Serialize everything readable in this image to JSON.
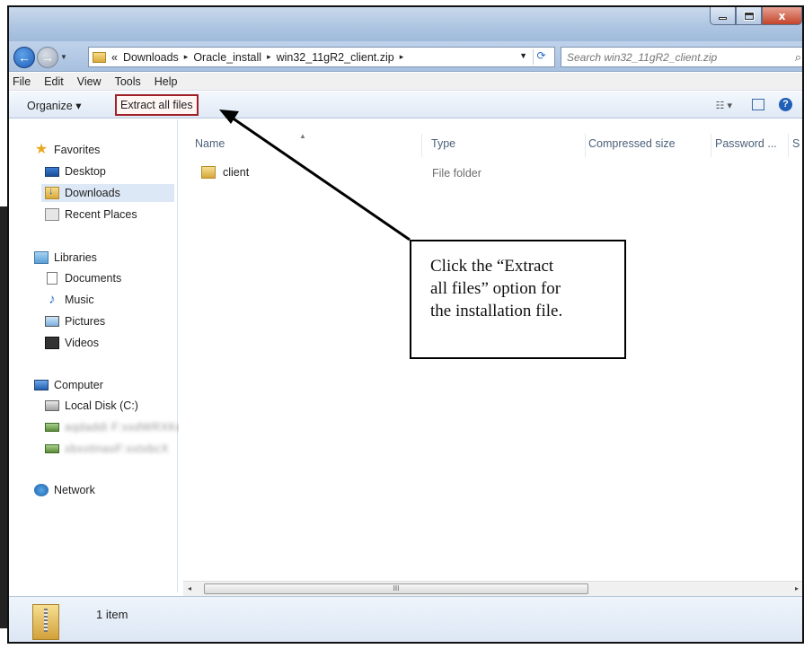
{
  "window": {
    "close_glyph": "x"
  },
  "address_bar": {
    "overflow": "«",
    "crumbs": [
      "Downloads",
      "Oracle_install",
      "win32_11gR2_client.zip"
    ],
    "separator": "▸"
  },
  "search": {
    "placeholder": "Search win32_11gR2_client.zip"
  },
  "menu": {
    "file": "File",
    "edit": "Edit",
    "view": "View",
    "tools": "Tools",
    "help": "Help"
  },
  "toolbar": {
    "organize": "Organize ▾",
    "extract_all": "Extract all files",
    "views_glyph": "☷ ▾",
    "help_glyph": "?"
  },
  "nav": {
    "favorites": "Favorites",
    "desktop": "Desktop",
    "downloads": "Downloads",
    "recent": "Recent Places",
    "libraries": "Libraries",
    "documents": "Documents",
    "music": "Music",
    "pictures": "Pictures",
    "videos": "Videos",
    "computer": "Computer",
    "local_disk": "Local Disk (C:)",
    "network_drive_1": "aqdaddi F:xxdWRXKe",
    "network_drive_2": "xbxxtinaxF:xxtxbcX",
    "network": "Network"
  },
  "columns": {
    "name": "Name",
    "type": "Type",
    "compressed_size": "Compressed size",
    "password": "Password ...",
    "size_partial": "S"
  },
  "files": [
    {
      "name": "client",
      "type": "File folder"
    }
  ],
  "scrollbar": {
    "grip": "III",
    "left": "◂",
    "right": "▸"
  },
  "details": {
    "count": "1 item"
  },
  "callout": {
    "line1": "Click the “Extract",
    "line2": "all files” option for",
    "line3": "the installation file."
  }
}
